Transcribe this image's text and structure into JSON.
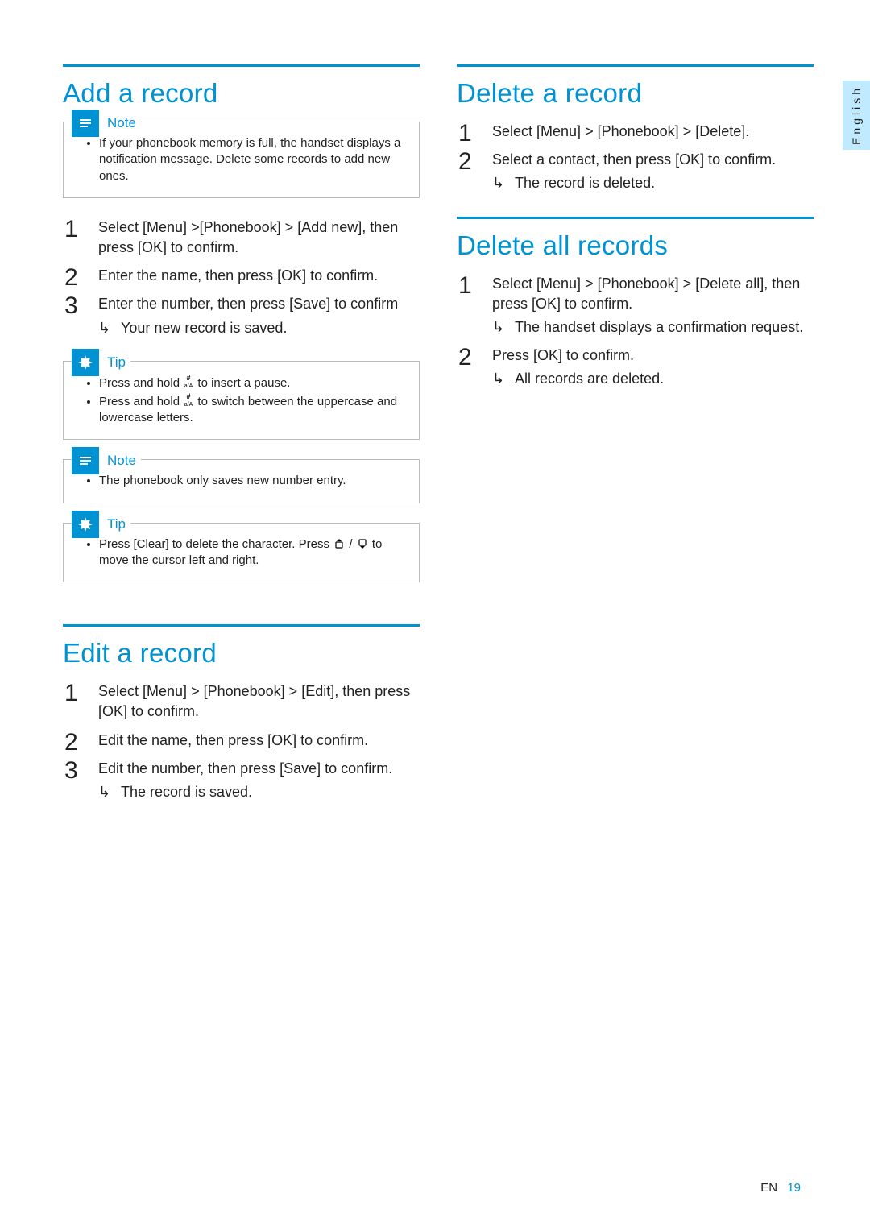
{
  "lang_tab": "English",
  "footer": {
    "lang": "EN",
    "page": "19"
  },
  "labels": {
    "note": "Note",
    "tip": "Tip"
  },
  "left": {
    "add": {
      "heading": "Add a record",
      "note1": "If your phonebook memory is full, the handset displays a notification message. Delete some records to add new ones.",
      "steps": [
        {
          "text_pre": "Select ",
          "b1": "[Menu]",
          "mid1": " >",
          "b2": "[Phonebook]",
          "mid2": " > ",
          "b3": "[Add new]",
          "tail": ", then press ",
          "b4": "[OK]",
          "tail2": " to confirm."
        },
        {
          "text_pre": "Enter the name, then press ",
          "b1": "[OK]",
          "tail": " to confirm."
        },
        {
          "text_pre": "Enter the number, then press ",
          "b1": "[Save]",
          "tail": " to confirm",
          "result": "Your new record is saved."
        }
      ],
      "tip1": {
        "li1_pre": "Press and hold ",
        "li1_post": " to insert a pause.",
        "li2_pre": "Press and hold ",
        "li2_post": " to switch between the uppercase and lowercase letters."
      },
      "note2": "The phonebook only saves new number entry.",
      "tip2_pre": "Press ",
      "tip2_b": "[Clear]",
      "tip2_mid": " to delete the character. Press ",
      "tip2_post": " to move the cursor left and right."
    },
    "edit": {
      "heading": "Edit a record",
      "steps": [
        {
          "text_pre": "Select ",
          "b1": "[Menu]",
          "mid1": " > ",
          "b2": "[Phonebook]",
          "mid2": " > ",
          "b3": "[Edit]",
          "tail": ", then press ",
          "b4": "[OK]",
          "tail2": " to confirm."
        },
        {
          "text_pre": "Edit the name, then press ",
          "b1": "[OK]",
          "tail": " to confirm."
        },
        {
          "text_pre": "Edit the number, then press ",
          "b1": "[Save]",
          "tail": " to confirm.",
          "result": "The record is saved."
        }
      ]
    }
  },
  "right": {
    "del": {
      "heading": "Delete a record",
      "steps": [
        {
          "text_pre": "Select ",
          "b1": "[Menu]",
          "mid1": " > ",
          "b2": "[Phonebook]",
          "mid2": " > ",
          "b3": "[Delete]",
          "tail": "."
        },
        {
          "text_pre": "Select a contact, then press ",
          "b1": "[OK]",
          "tail": " to confirm.",
          "result": "The record is deleted."
        }
      ]
    },
    "delall": {
      "heading": "Delete all records",
      "steps": [
        {
          "text_pre": "Select ",
          "b1": "[Menu]",
          "mid1": " > ",
          "b2": "[Phonebook]",
          "mid2": " > ",
          "b3": "[Delete all]",
          "tail": ", then press ",
          "b4": "[OK]",
          "tail2": " to confirm.",
          "result": "The handset displays a confirmation request."
        },
        {
          "text_pre": "Press ",
          "b1": "[OK]",
          "tail": " to confirm.",
          "result": "All records are deleted."
        }
      ]
    }
  }
}
